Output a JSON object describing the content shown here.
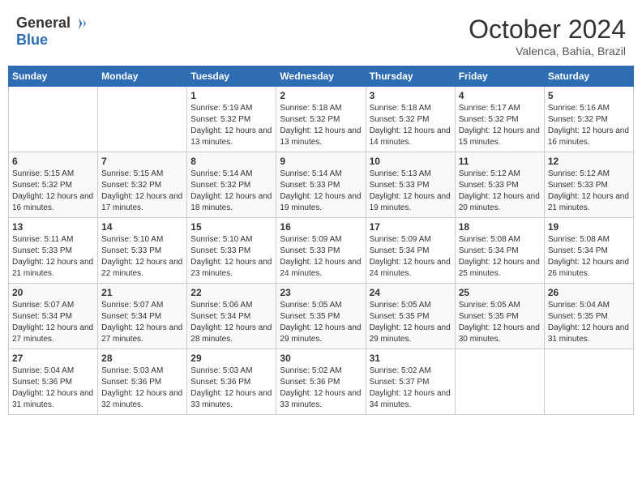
{
  "logo": {
    "line1": "General",
    "line2": "Blue"
  },
  "title": "October 2024",
  "location": "Valenca, Bahia, Brazil",
  "days_of_week": [
    "Sunday",
    "Monday",
    "Tuesday",
    "Wednesday",
    "Thursday",
    "Friday",
    "Saturday"
  ],
  "weeks": [
    [
      {
        "day": "",
        "content": ""
      },
      {
        "day": "",
        "content": ""
      },
      {
        "day": "1",
        "content": "Sunrise: 5:19 AM\nSunset: 5:32 PM\nDaylight: 12 hours and 13 minutes."
      },
      {
        "day": "2",
        "content": "Sunrise: 5:18 AM\nSunset: 5:32 PM\nDaylight: 12 hours and 13 minutes."
      },
      {
        "day": "3",
        "content": "Sunrise: 5:18 AM\nSunset: 5:32 PM\nDaylight: 12 hours and 14 minutes."
      },
      {
        "day": "4",
        "content": "Sunrise: 5:17 AM\nSunset: 5:32 PM\nDaylight: 12 hours and 15 minutes."
      },
      {
        "day": "5",
        "content": "Sunrise: 5:16 AM\nSunset: 5:32 PM\nDaylight: 12 hours and 16 minutes."
      }
    ],
    [
      {
        "day": "6",
        "content": "Sunrise: 5:15 AM\nSunset: 5:32 PM\nDaylight: 12 hours and 16 minutes."
      },
      {
        "day": "7",
        "content": "Sunrise: 5:15 AM\nSunset: 5:32 PM\nDaylight: 12 hours and 17 minutes."
      },
      {
        "day": "8",
        "content": "Sunrise: 5:14 AM\nSunset: 5:32 PM\nDaylight: 12 hours and 18 minutes."
      },
      {
        "day": "9",
        "content": "Sunrise: 5:14 AM\nSunset: 5:33 PM\nDaylight: 12 hours and 19 minutes."
      },
      {
        "day": "10",
        "content": "Sunrise: 5:13 AM\nSunset: 5:33 PM\nDaylight: 12 hours and 19 minutes."
      },
      {
        "day": "11",
        "content": "Sunrise: 5:12 AM\nSunset: 5:33 PM\nDaylight: 12 hours and 20 minutes."
      },
      {
        "day": "12",
        "content": "Sunrise: 5:12 AM\nSunset: 5:33 PM\nDaylight: 12 hours and 21 minutes."
      }
    ],
    [
      {
        "day": "13",
        "content": "Sunrise: 5:11 AM\nSunset: 5:33 PM\nDaylight: 12 hours and 21 minutes."
      },
      {
        "day": "14",
        "content": "Sunrise: 5:10 AM\nSunset: 5:33 PM\nDaylight: 12 hours and 22 minutes."
      },
      {
        "day": "15",
        "content": "Sunrise: 5:10 AM\nSunset: 5:33 PM\nDaylight: 12 hours and 23 minutes."
      },
      {
        "day": "16",
        "content": "Sunrise: 5:09 AM\nSunset: 5:33 PM\nDaylight: 12 hours and 24 minutes."
      },
      {
        "day": "17",
        "content": "Sunrise: 5:09 AM\nSunset: 5:34 PM\nDaylight: 12 hours and 24 minutes."
      },
      {
        "day": "18",
        "content": "Sunrise: 5:08 AM\nSunset: 5:34 PM\nDaylight: 12 hours and 25 minutes."
      },
      {
        "day": "19",
        "content": "Sunrise: 5:08 AM\nSunset: 5:34 PM\nDaylight: 12 hours and 26 minutes."
      }
    ],
    [
      {
        "day": "20",
        "content": "Sunrise: 5:07 AM\nSunset: 5:34 PM\nDaylight: 12 hours and 27 minutes."
      },
      {
        "day": "21",
        "content": "Sunrise: 5:07 AM\nSunset: 5:34 PM\nDaylight: 12 hours and 27 minutes."
      },
      {
        "day": "22",
        "content": "Sunrise: 5:06 AM\nSunset: 5:34 PM\nDaylight: 12 hours and 28 minutes."
      },
      {
        "day": "23",
        "content": "Sunrise: 5:05 AM\nSunset: 5:35 PM\nDaylight: 12 hours and 29 minutes."
      },
      {
        "day": "24",
        "content": "Sunrise: 5:05 AM\nSunset: 5:35 PM\nDaylight: 12 hours and 29 minutes."
      },
      {
        "day": "25",
        "content": "Sunrise: 5:05 AM\nSunset: 5:35 PM\nDaylight: 12 hours and 30 minutes."
      },
      {
        "day": "26",
        "content": "Sunrise: 5:04 AM\nSunset: 5:35 PM\nDaylight: 12 hours and 31 minutes."
      }
    ],
    [
      {
        "day": "27",
        "content": "Sunrise: 5:04 AM\nSunset: 5:36 PM\nDaylight: 12 hours and 31 minutes."
      },
      {
        "day": "28",
        "content": "Sunrise: 5:03 AM\nSunset: 5:36 PM\nDaylight: 12 hours and 32 minutes."
      },
      {
        "day": "29",
        "content": "Sunrise: 5:03 AM\nSunset: 5:36 PM\nDaylight: 12 hours and 33 minutes."
      },
      {
        "day": "30",
        "content": "Sunrise: 5:02 AM\nSunset: 5:36 PM\nDaylight: 12 hours and 33 minutes."
      },
      {
        "day": "31",
        "content": "Sunrise: 5:02 AM\nSunset: 5:37 PM\nDaylight: 12 hours and 34 minutes."
      },
      {
        "day": "",
        "content": ""
      },
      {
        "day": "",
        "content": ""
      }
    ]
  ]
}
